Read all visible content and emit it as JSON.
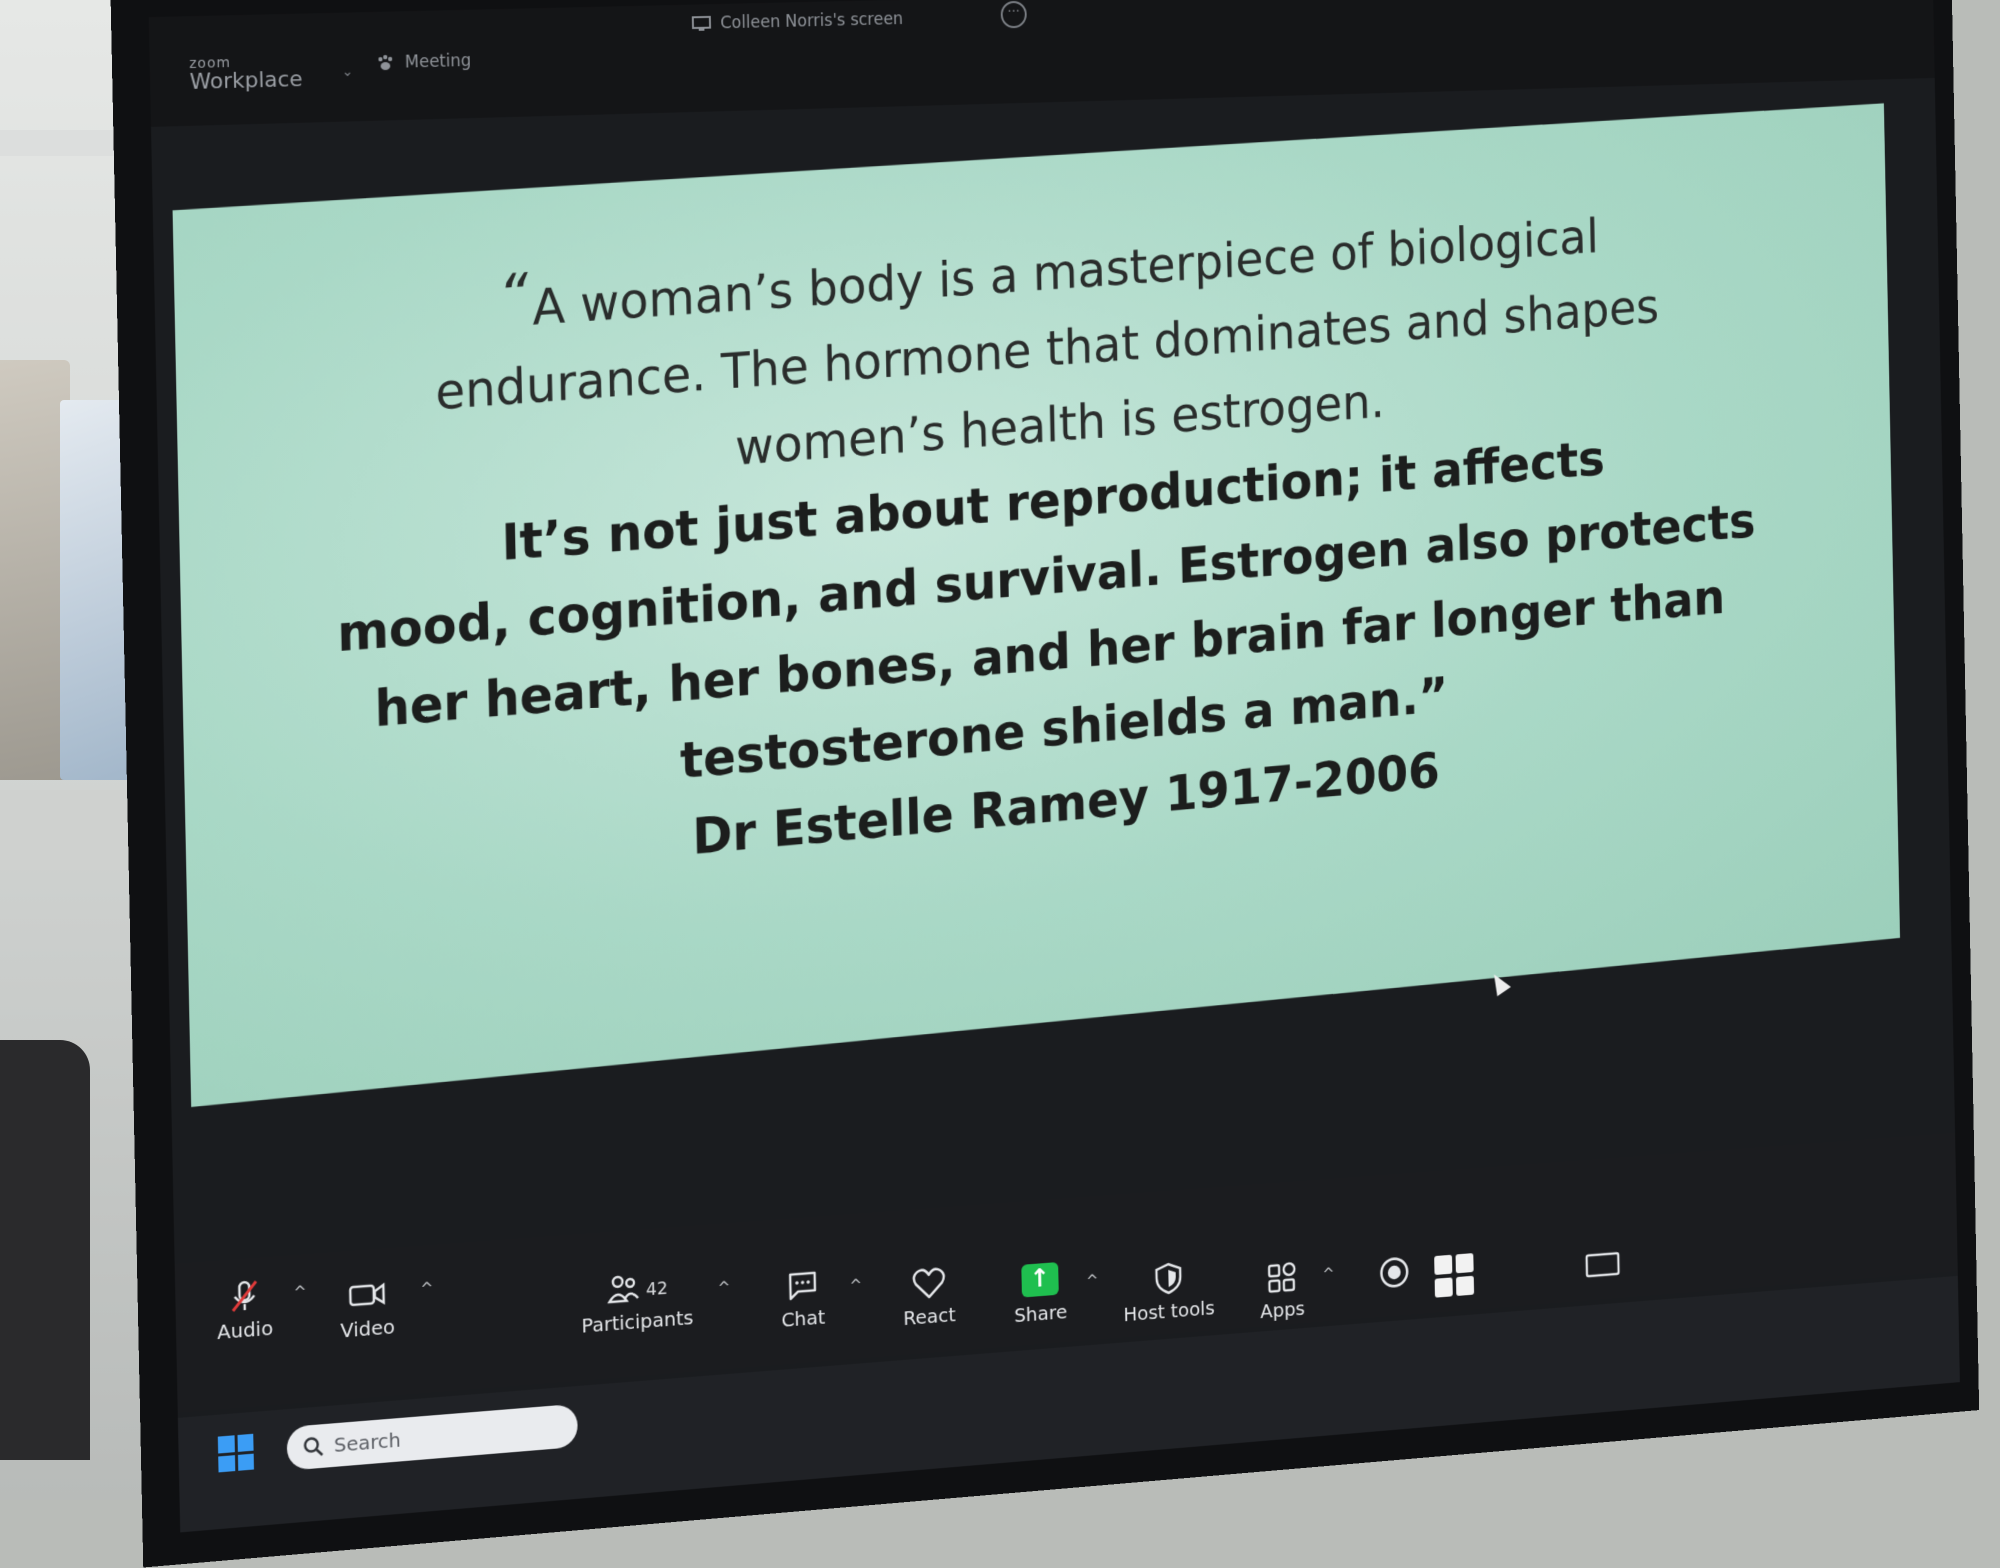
{
  "app": {
    "brand_small": "zoom",
    "brand_name": "Workplace",
    "meeting_label": "Meeting",
    "screen_label": "Colleen Norris's screen"
  },
  "slide": {
    "quote_lines": [
      "A woman’s body is a masterpiece of biological",
      "endurance. The hormone that dominates and shapes",
      "women’s health is estrogen."
    ],
    "bold_lines": [
      "It’s not just about reproduction; it affects",
      "mood, cognition, and survival. Estrogen also protects",
      "her heart, her bones, and her brain far longer than",
      "testosterone shields a man.”",
      "Dr Estelle Ramey 1917-2006"
    ],
    "open_quote": "“"
  },
  "toolbar": {
    "audio_label": "Audio",
    "video_label": "Video",
    "participants_label": "Participants",
    "participants_count": "42",
    "chat_label": "Chat",
    "react_label": "React",
    "share_label": "Share",
    "host_tools_label": "Host tools",
    "apps_label": "Apps",
    "caret": "^",
    "share_arrow": "↑"
  },
  "taskbar": {
    "search_placeholder": "Search"
  },
  "colors": {
    "slide_bg": "#a9d8c6",
    "share_green": "#1fbf4f",
    "windows_blue": "#3b9df5",
    "toolbar_bg": "#1b1c1f"
  }
}
